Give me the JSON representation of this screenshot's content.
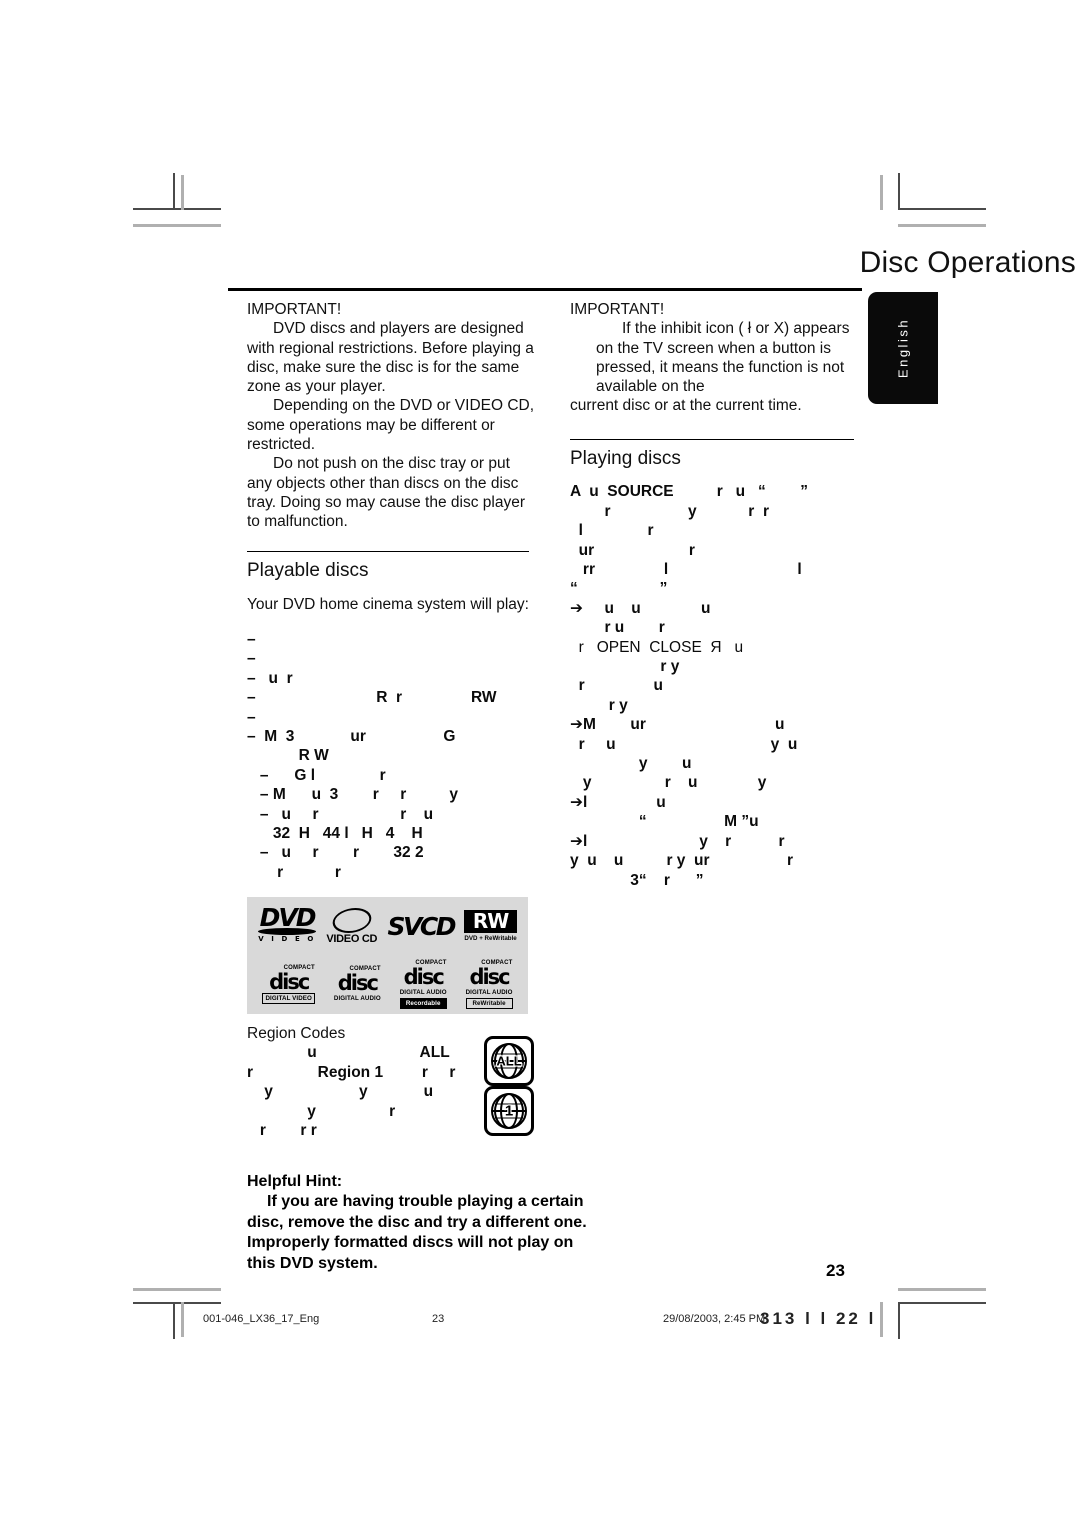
{
  "header": {
    "title": "Disc Operations",
    "language_tab": "English"
  },
  "left_column": {
    "important_heading": "IMPORTANT!",
    "important_paragraphs": [
      "DVD discs and players are designed with regional restrictions. Before playing a disc, make sure the disc is for the same zone as your player.",
      "Depending on the DVD or VIDEO CD, some operations may be different or restricted.",
      "Do not push on the disc tray or put any objects other than discs on the disc tray.  Doing so may cause the disc player to malfunction."
    ],
    "playable_discs": {
      "heading": "Playable discs",
      "intro": "Your DVD home cinema system will play:",
      "items": [
        "–",
        "–",
        "–   u  r",
        "–                            R  r                RW",
        "–",
        "–  M  3             ur                  G",
        "            R W",
        "   –      G l               r",
        "   – M      u  3        r     r          y",
        "   –   u     r                   r    u",
        "      32  H   44 l   H   4    H",
        "   –   u     r        r        32 2",
        "       r            r"
      ]
    },
    "region_codes": {
      "heading": "Region Codes",
      "lines": [
        "              u                        ALL",
        "r               Region 1         r     r",
        "    y                    y             u",
        "              y                 r",
        "   r        r r"
      ],
      "badges": [
        "ALL",
        "1"
      ]
    },
    "helpful_hint": {
      "heading": "Helpful Hint:",
      "body": "If you are having trouble playing a certain disc, remove the disc and try a different one. Improperly formatted discs will not play on this DVD system."
    }
  },
  "right_column": {
    "important_heading": "IMPORTANT!",
    "important_paragraphs": [
      "If the inhibit icon (  ł  or X) appears on the TV screen when a button is pressed, it means the function is not available on the",
      "current disc or at the current time."
    ],
    "playing_discs": {
      "heading": "Playing discs",
      "lines": [
        "A  u  SOURCE          r   u   “        ”",
        "        r                  y            r  r",
        "  l               r",
        "",
        "  ur                      r",
        "   rr                l                              l",
        "“                   ”",
        "➔     u    u              u",
        "        r u        r",
        "",
        "  r   OPEN  CLOSE  Я   u",
        "                     r y",
        "  r                u",
        "         r y",
        "➔M        ur                              u",
        "  r     u                                    y  u",
        "                y        u",
        "",
        "   y                 r    u              y",
        "➔l                u",
        "                “                  M ”u",
        "➔l                          y    r           r",
        "y  u    u          r y  ur                  r",
        "              3“    r      ”"
      ]
    }
  },
  "logos": {
    "row1": [
      {
        "name": "dvd-video-logo",
        "main": "DVD",
        "sub": "V I D E O"
      },
      {
        "name": "video-cd-logo",
        "main": "VIDEO CD"
      },
      {
        "name": "svcd-logo",
        "main": "SVCD"
      },
      {
        "name": "dvd-plus-rw-logo",
        "main": "RW",
        "sub": "DVD + ReWritable"
      }
    ],
    "row2": [
      {
        "name": "compact-disc-digital-video-logo",
        "top": "COMPACT",
        "mid": "disc",
        "bot": "DIGITAL VIDEO"
      },
      {
        "name": "compact-disc-digital-audio-logo",
        "top": "COMPACT",
        "mid": "disc",
        "bot": "DIGITAL AUDIO"
      },
      {
        "name": "compact-disc-recordable-logo",
        "top": "COMPACT",
        "mid": "disc",
        "bot2": "DIGITAL AUDIO",
        "bot": "Recordable"
      },
      {
        "name": "compact-disc-rewritable-logo",
        "top": "COMPACT",
        "mid": "disc",
        "bot2": "DIGITAL AUDIO",
        "bot": "ReWritable"
      }
    ]
  },
  "footer": {
    "file_id": "001-046_LX36_17_Eng",
    "page_label": "23",
    "timestamp": "29/08/2003, 2:45 PM",
    "overlap_glyphs": "313  l l  22  l",
    "page_number": "23"
  }
}
